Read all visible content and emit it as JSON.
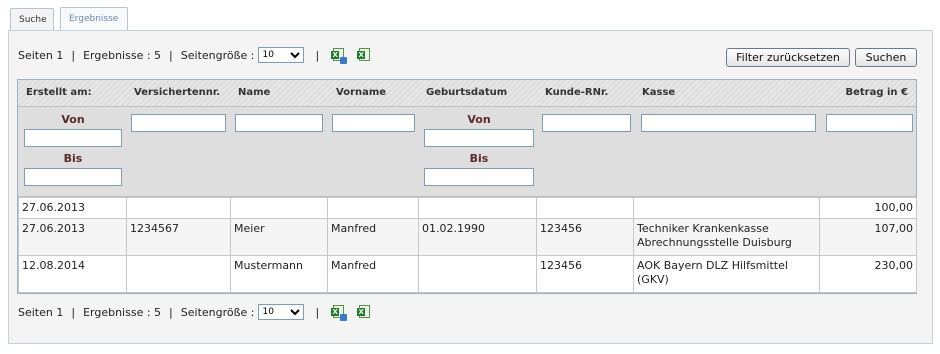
{
  "tabs": [
    {
      "label": "Suche"
    },
    {
      "label": "Ergebnisse"
    }
  ],
  "pager": {
    "pages_label": "Seiten 1",
    "results_label": "Ergebnisse : 5",
    "pagesize_label": "Seitengröße :",
    "pagesize_value": "10",
    "divider": "|",
    "sep": "|"
  },
  "buttons": {
    "reset": "Filter zurücksetzen",
    "search": "Suchen"
  },
  "columns": [
    {
      "label": "Erstellt am:"
    },
    {
      "label": "Versichertennr."
    },
    {
      "label": "Name"
    },
    {
      "label": "Vorname"
    },
    {
      "label": "Geburtsdatum"
    },
    {
      "label": "Kunde-RNr."
    },
    {
      "label": "Kasse"
    },
    {
      "label": "Betrag in €"
    }
  ],
  "filters": {
    "von_label": "Von",
    "bis_label": "Bis"
  },
  "rows": [
    {
      "erstellt": "27.06.2013",
      "versnr": "",
      "name": "",
      "vorname": "",
      "geburt": "",
      "kunde": "",
      "kasse_1": "",
      "kasse_2": "",
      "betrag": "100,00"
    },
    {
      "erstellt": "27.06.2013",
      "versnr": "1234567",
      "name": "Meier",
      "vorname": "Manfred",
      "geburt": "01.02.1990",
      "kunde": "123456",
      "kasse_1": "Techniker Krankenkasse",
      "kasse_2": "Abrechnungsstelle Duisburg",
      "betrag": "107,00"
    },
    {
      "erstellt": "12.08.2014",
      "versnr": "",
      "name": "Mustermann",
      "vorname": "Manfred",
      "geburt": "",
      "kunde": "123456",
      "kasse_1": "AOK Bayern DLZ Hilfsmittel",
      "kasse_2": "(GKV)",
      "betrag": "230,00"
    }
  ],
  "icons": [
    "excel-export-icon",
    "excel-icon"
  ]
}
